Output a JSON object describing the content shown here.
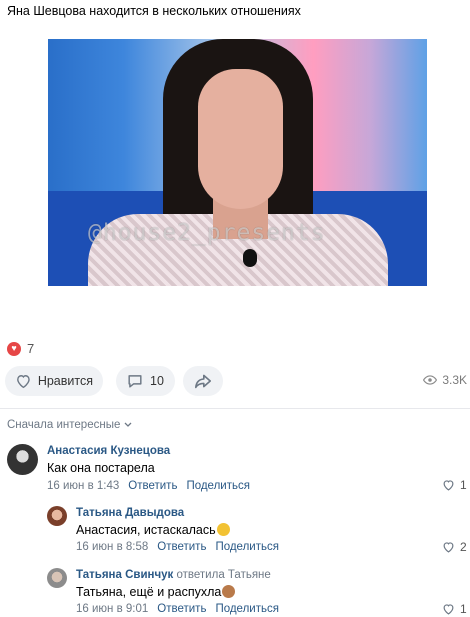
{
  "post": {
    "text": "Яна Шевцова находится в нескольких отношениях",
    "video_watermark": "@house2_presents"
  },
  "reactions": {
    "count": "7",
    "icon": "heart-icon",
    "color": "#e64646"
  },
  "actions": {
    "like_label": "Нравится",
    "comments_count": "10",
    "views": "3.3K"
  },
  "comments_sort": "Сначала интересные",
  "comments": [
    {
      "author": "Анастасия Кузнецова",
      "text": "Как она постарела",
      "date": "16 июн в 1:43",
      "reply_label": "Ответить",
      "share_label": "Поделиться",
      "likes": "1"
    },
    {
      "author": "Татьяна Давыдова",
      "text": "Анастасия, истаскалась",
      "emoji": "smirk-emoji",
      "date": "16 июн в 8:58",
      "reply_label": "Ответить",
      "share_label": "Поделиться",
      "likes": "2"
    },
    {
      "author": "Татьяна Свинчук",
      "replied_to": "ответила Татьяне",
      "text": "Татьяна, ещё и распухла",
      "emoji": "see-no-evil-monkey-emoji",
      "date": "16 июн в 9:01",
      "reply_label": "Ответить",
      "share_label": "Поделиться",
      "likes": "1"
    }
  ],
  "colors": {
    "link": "#2a5885",
    "meta": "#6d7885",
    "pill_bg": "#f0f2f5"
  }
}
